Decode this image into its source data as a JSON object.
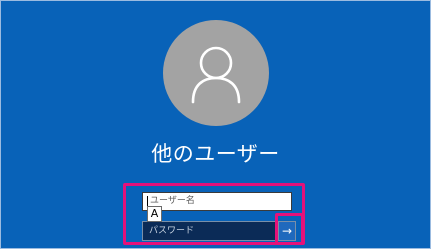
{
  "lock_screen": {
    "account_name": "他のユーザー",
    "avatar_icon": "user-silhouette-icon",
    "username_field": {
      "placeholder": "ユーザー名",
      "value": ""
    },
    "password_field": {
      "placeholder": "パスワード",
      "value": ""
    },
    "submit_icon": "arrow-right-icon",
    "submit_glyph": "→",
    "ime_indicator": "A"
  },
  "colors": {
    "background": "#0862b8",
    "avatar": "#a3a3a3",
    "highlight": "#e5117a",
    "password_field_bg": "#0b2b57",
    "submit_button_bg": "#1f69bd"
  }
}
